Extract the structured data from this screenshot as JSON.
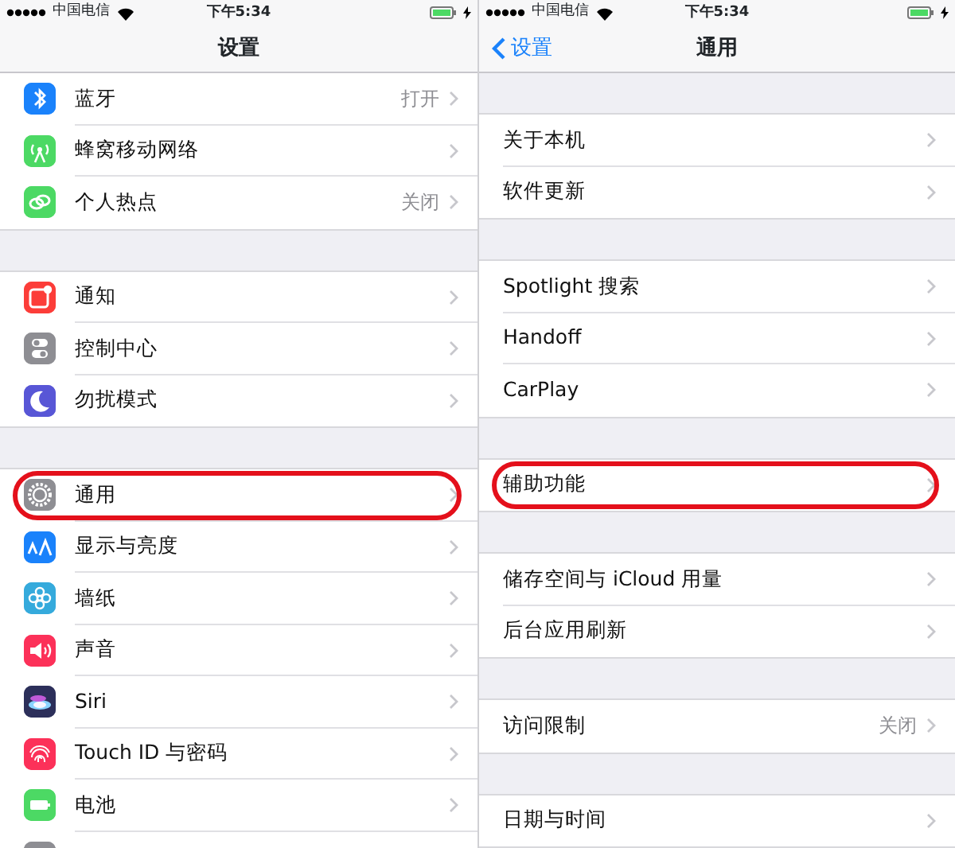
{
  "screens": [
    {
      "status_bar": {
        "carrier": "中国电信",
        "time": "下午5:34"
      },
      "nav": {
        "title": "设置"
      },
      "groups": [
        {
          "rows": [
            {
              "label": "蓝牙",
              "value": "打开",
              "color": "#1a82fb",
              "highlighted": false
            },
            {
              "label": "蜂窝移动网络",
              "color": "#4cd964",
              "highlighted": false
            },
            {
              "label": "个人热点",
              "value": "关闭",
              "color": "#4cd964",
              "highlighted": false
            }
          ]
        },
        {
          "rows": [
            {
              "label": "通知",
              "color": "#fc3d39",
              "highlighted": false
            },
            {
              "label": "控制中心",
              "color": "#8e8e93",
              "highlighted": false
            },
            {
              "label": "勿扰模式",
              "color": "#5856d6",
              "highlighted": false
            }
          ]
        },
        {
          "rows": [
            {
              "label": "通用",
              "color": "#8e8e93",
              "highlighted": true
            },
            {
              "label": "显示与亮度",
              "color": "#1a82fb",
              "highlighted": false
            },
            {
              "label": "墙纸",
              "color": "#35aadc",
              "highlighted": false
            },
            {
              "label": "声音",
              "color": "#fc3159",
              "highlighted": false
            },
            {
              "label": "Siri",
              "color": "#2c2f5a",
              "highlighted": false
            },
            {
              "label": "Touch ID 与密码",
              "color": "#fc3159",
              "highlighted": false
            },
            {
              "label": "电池",
              "color": "#4cd964",
              "highlighted": false
            },
            {
              "color": "#8e8e93",
              "highlighted": false
            }
          ]
        }
      ]
    },
    {
      "status_bar": {
        "carrier": "中国电信",
        "time": "下午5:34"
      },
      "nav": {
        "title": "通用",
        "back": "设置"
      },
      "groups": [
        {
          "rows": [
            {
              "label": "关于本机",
              "highlighted": false
            },
            {
              "label": "软件更新",
              "highlighted": false
            }
          ]
        },
        {
          "rows": [
            {
              "label": "Spotlight 搜索",
              "highlighted": false
            },
            {
              "label": "Handoff",
              "highlighted": false
            },
            {
              "label": "CarPlay",
              "highlighted": false
            }
          ]
        },
        {
          "rows": [
            {
              "label": "辅助功能",
              "highlighted": true
            }
          ]
        },
        {
          "rows": [
            {
              "label": "储存空间与 iCloud 用量",
              "highlighted": false
            },
            {
              "label": "后台应用刷新",
              "highlighted": false
            }
          ]
        },
        {
          "rows": [
            {
              "label": "访问限制",
              "value": "关闭",
              "highlighted": false
            }
          ]
        },
        {
          "rows": [
            {
              "label": "日期与时间",
              "highlighted": false
            }
          ]
        }
      ]
    }
  ]
}
